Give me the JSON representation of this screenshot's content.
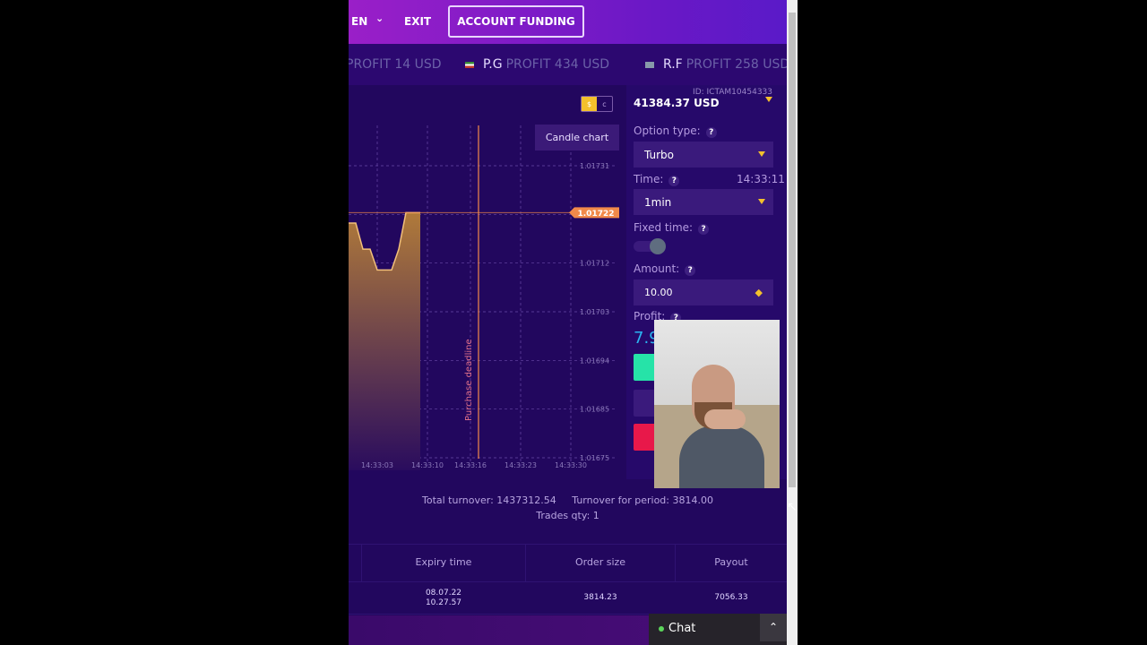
{
  "topbar": {
    "language": "EN",
    "exit": "EXIT",
    "account_funding": "ACCOUNT FUNDING"
  },
  "ticker": [
    {
      "name": "",
      "profit": "PROFIT 14 USD",
      "flag_color": "#ffffff"
    },
    {
      "name": "P.G",
      "profit": "PROFIT 434 USD",
      "flag_color": "#c0392b"
    },
    {
      "name": "R.F",
      "profit": "PROFIT 258 USD",
      "flag_color": "#8899aa"
    }
  ],
  "currency_toggle": {
    "usd": "$",
    "other": "c"
  },
  "account": {
    "id": "ID: ICTAM10454333",
    "balance": "41384.37 USD"
  },
  "chart": {
    "button": "Candle chart",
    "current_price": "1.01722",
    "deadline_label": "Purchase deadline",
    "y_ticks": [
      "1.01731",
      "1.01722",
      "1.01712",
      "1.01703",
      "1.01694",
      "1.01685",
      "1.01675"
    ],
    "x_ticks": [
      "14:33:03",
      "14:33:10",
      "14:33:16",
      "14:33:23",
      "14:33:30"
    ]
  },
  "chart_data": {
    "type": "area",
    "x": [
      "14:32:59",
      "14:33:00",
      "14:33:01",
      "14:33:02",
      "14:33:03",
      "14:33:04",
      "14:33:05",
      "14:33:06",
      "14:33:07",
      "14:33:08",
      "14:33:09"
    ],
    "y": [
      1.0172,
      1.0172,
      1.01715,
      1.01715,
      1.01711,
      1.01711,
      1.01711,
      1.01715,
      1.01722,
      1.01722,
      1.01722
    ],
    "ylim": [
      1.01675,
      1.01731
    ],
    "grid": true,
    "accent": "#f28a4a"
  },
  "panel": {
    "option_type_label": "Option type:",
    "option_type": "Turbo",
    "time_label": "Time:",
    "time_now": "14:33:11",
    "time_value": "1min",
    "fixed_time_label": "Fixed time:",
    "fixed_time_on": false,
    "amount_label": "Amount:",
    "amount": "10.00",
    "profit_label": "Profit:",
    "profit": "7.9",
    "help": "?"
  },
  "stats": {
    "total_turnover": "Total turnover: 1437312.54",
    "period_turnover": "Turnover for period: 3814.00",
    "trades": "Trades qty: 1"
  },
  "table": {
    "headers": [
      "Expiry time",
      "Order size",
      "Payout"
    ],
    "rows": [
      {
        "expiry_date": "08.07.22",
        "expiry_time": "10.27.57",
        "order_size": "3814.23",
        "payout": "7056.33"
      }
    ]
  },
  "chat": {
    "label": "Chat"
  }
}
